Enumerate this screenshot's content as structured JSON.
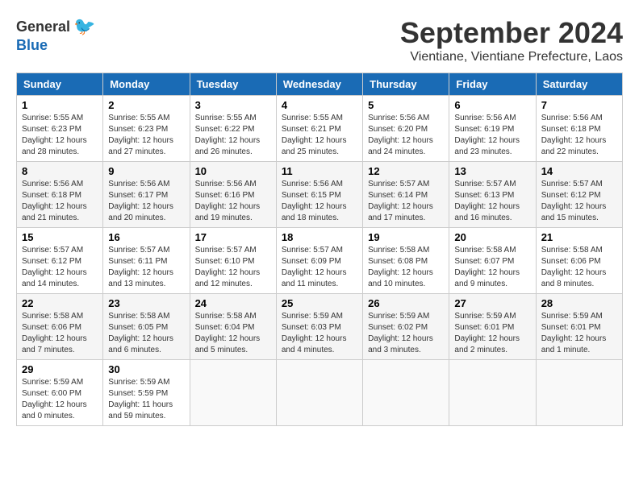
{
  "logo": {
    "general": "General",
    "blue": "Blue"
  },
  "title": "September 2024",
  "location": "Vientiane, Vientiane Prefecture, Laos",
  "days_header": [
    "Sunday",
    "Monday",
    "Tuesday",
    "Wednesday",
    "Thursday",
    "Friday",
    "Saturday"
  ],
  "weeks": [
    [
      {
        "day": "1",
        "sunrise": "5:55 AM",
        "sunset": "6:23 PM",
        "daylight": "12 hours and 28 minutes."
      },
      {
        "day": "2",
        "sunrise": "5:55 AM",
        "sunset": "6:23 PM",
        "daylight": "12 hours and 27 minutes."
      },
      {
        "day": "3",
        "sunrise": "5:55 AM",
        "sunset": "6:22 PM",
        "daylight": "12 hours and 26 minutes."
      },
      {
        "day": "4",
        "sunrise": "5:55 AM",
        "sunset": "6:21 PM",
        "daylight": "12 hours and 25 minutes."
      },
      {
        "day": "5",
        "sunrise": "5:56 AM",
        "sunset": "6:20 PM",
        "daylight": "12 hours and 24 minutes."
      },
      {
        "day": "6",
        "sunrise": "5:56 AM",
        "sunset": "6:19 PM",
        "daylight": "12 hours and 23 minutes."
      },
      {
        "day": "7",
        "sunrise": "5:56 AM",
        "sunset": "6:18 PM",
        "daylight": "12 hours and 22 minutes."
      }
    ],
    [
      {
        "day": "8",
        "sunrise": "5:56 AM",
        "sunset": "6:18 PM",
        "daylight": "12 hours and 21 minutes."
      },
      {
        "day": "9",
        "sunrise": "5:56 AM",
        "sunset": "6:17 PM",
        "daylight": "12 hours and 20 minutes."
      },
      {
        "day": "10",
        "sunrise": "5:56 AM",
        "sunset": "6:16 PM",
        "daylight": "12 hours and 19 minutes."
      },
      {
        "day": "11",
        "sunrise": "5:56 AM",
        "sunset": "6:15 PM",
        "daylight": "12 hours and 18 minutes."
      },
      {
        "day": "12",
        "sunrise": "5:57 AM",
        "sunset": "6:14 PM",
        "daylight": "12 hours and 17 minutes."
      },
      {
        "day": "13",
        "sunrise": "5:57 AM",
        "sunset": "6:13 PM",
        "daylight": "12 hours and 16 minutes."
      },
      {
        "day": "14",
        "sunrise": "5:57 AM",
        "sunset": "6:12 PM",
        "daylight": "12 hours and 15 minutes."
      }
    ],
    [
      {
        "day": "15",
        "sunrise": "5:57 AM",
        "sunset": "6:12 PM",
        "daylight": "12 hours and 14 minutes."
      },
      {
        "day": "16",
        "sunrise": "5:57 AM",
        "sunset": "6:11 PM",
        "daylight": "12 hours and 13 minutes."
      },
      {
        "day": "17",
        "sunrise": "5:57 AM",
        "sunset": "6:10 PM",
        "daylight": "12 hours and 12 minutes."
      },
      {
        "day": "18",
        "sunrise": "5:57 AM",
        "sunset": "6:09 PM",
        "daylight": "12 hours and 11 minutes."
      },
      {
        "day": "19",
        "sunrise": "5:58 AM",
        "sunset": "6:08 PM",
        "daylight": "12 hours and 10 minutes."
      },
      {
        "day": "20",
        "sunrise": "5:58 AM",
        "sunset": "6:07 PM",
        "daylight": "12 hours and 9 minutes."
      },
      {
        "day": "21",
        "sunrise": "5:58 AM",
        "sunset": "6:06 PM",
        "daylight": "12 hours and 8 minutes."
      }
    ],
    [
      {
        "day": "22",
        "sunrise": "5:58 AM",
        "sunset": "6:06 PM",
        "daylight": "12 hours and 7 minutes."
      },
      {
        "day": "23",
        "sunrise": "5:58 AM",
        "sunset": "6:05 PM",
        "daylight": "12 hours and 6 minutes."
      },
      {
        "day": "24",
        "sunrise": "5:58 AM",
        "sunset": "6:04 PM",
        "daylight": "12 hours and 5 minutes."
      },
      {
        "day": "25",
        "sunrise": "5:59 AM",
        "sunset": "6:03 PM",
        "daylight": "12 hours and 4 minutes."
      },
      {
        "day": "26",
        "sunrise": "5:59 AM",
        "sunset": "6:02 PM",
        "daylight": "12 hours and 3 minutes."
      },
      {
        "day": "27",
        "sunrise": "5:59 AM",
        "sunset": "6:01 PM",
        "daylight": "12 hours and 2 minutes."
      },
      {
        "day": "28",
        "sunrise": "5:59 AM",
        "sunset": "6:01 PM",
        "daylight": "12 hours and 1 minute."
      }
    ],
    [
      {
        "day": "29",
        "sunrise": "5:59 AM",
        "sunset": "6:00 PM",
        "daylight": "12 hours and 0 minutes."
      },
      {
        "day": "30",
        "sunrise": "5:59 AM",
        "sunset": "5:59 PM",
        "daylight": "11 hours and 59 minutes."
      },
      null,
      null,
      null,
      null,
      null
    ]
  ]
}
